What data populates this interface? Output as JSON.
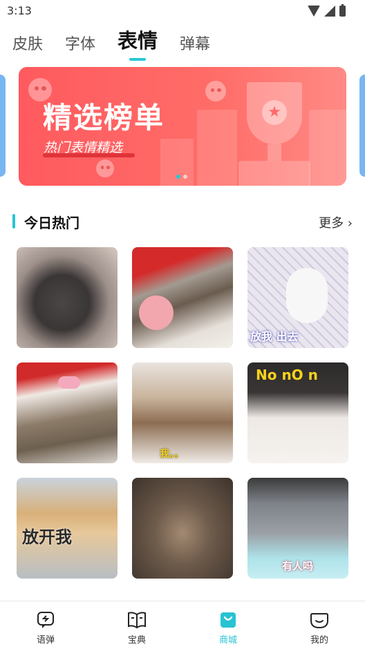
{
  "status": {
    "time": "3:13"
  },
  "tabs": [
    {
      "label": "皮肤",
      "active": false
    },
    {
      "label": "字体",
      "active": false
    },
    {
      "label": "表情",
      "active": true
    },
    {
      "label": "弹幕",
      "active": false
    }
  ],
  "banner": {
    "title": "精选榜单",
    "subtitle": "热门表情精选",
    "page_count": 2,
    "active_page": 1
  },
  "section": {
    "title": "今日热门",
    "more_label": "更多 ›"
  },
  "stickers": [
    {
      "name": "poodle",
      "caption": ""
    },
    {
      "name": "cat-with-flower",
      "caption": ""
    },
    {
      "name": "dog-in-cage",
      "caption": "放我    出去"
    },
    {
      "name": "cat-with-bow",
      "caption": ""
    },
    {
      "name": "kitten-peeking",
      "caption": "我。。"
    },
    {
      "name": "dog-no",
      "caption": "No nO n"
    },
    {
      "name": "shiba-leash",
      "caption": "放开我"
    },
    {
      "name": "dog-hallway",
      "caption": ""
    },
    {
      "name": "grey-cat",
      "caption": "有人吗"
    }
  ],
  "nav": [
    {
      "label": "语弹",
      "icon": "message-icon",
      "active": false
    },
    {
      "label": "宝典",
      "icon": "book-icon",
      "active": false
    },
    {
      "label": "商城",
      "icon": "shopping-bag-icon",
      "active": true
    },
    {
      "label": "我的",
      "icon": "smile-face-icon",
      "active": false
    }
  ],
  "colors": {
    "accent": "#28c6d6",
    "banner": "#ff5a5f"
  }
}
